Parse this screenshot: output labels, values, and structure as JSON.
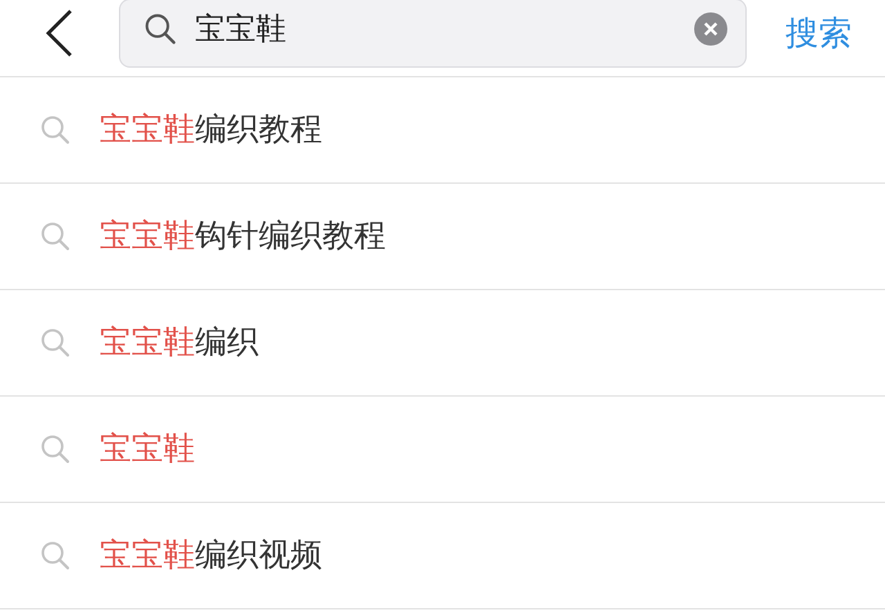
{
  "header": {
    "query": "宝宝鞋",
    "search_button": "搜索"
  },
  "suggestions": [
    {
      "match": "宝宝鞋",
      "rest": "编织教程"
    },
    {
      "match": "宝宝鞋",
      "rest": "钩针编织教程"
    },
    {
      "match": "宝宝鞋",
      "rest": "编织"
    },
    {
      "match": "宝宝鞋"
    },
    {
      "match": "宝宝鞋",
      "rest": "编织视频"
    }
  ]
}
